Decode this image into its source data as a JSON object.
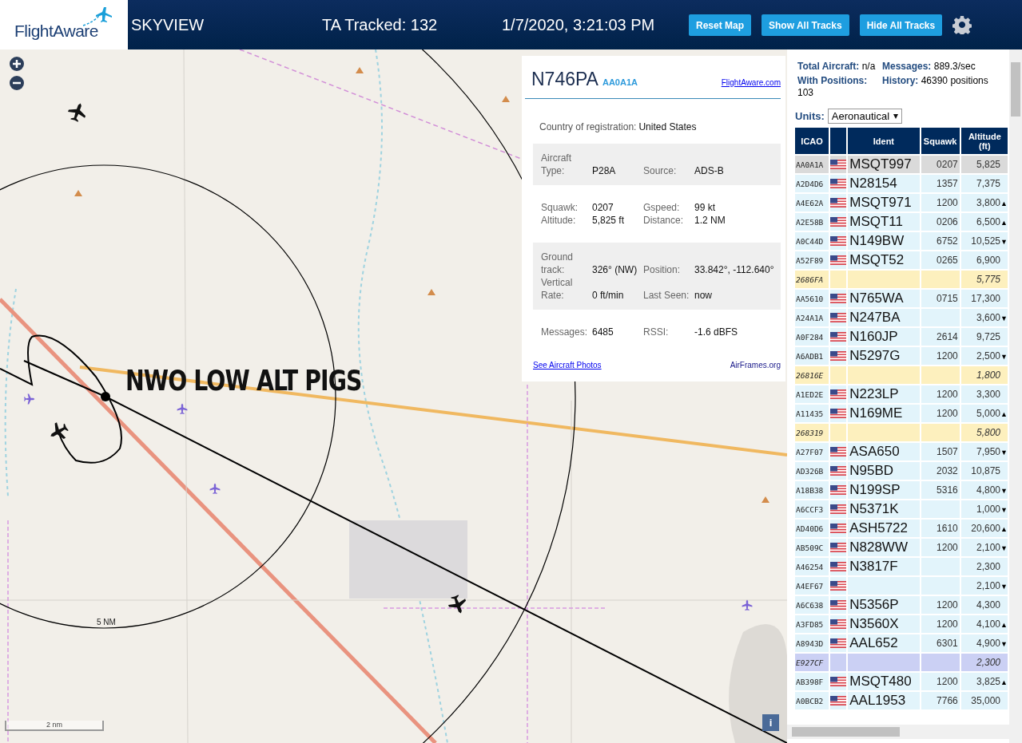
{
  "header": {
    "logo": "FlightAware",
    "title": "SKYVIEW",
    "tracked": "TA Tracked: 132",
    "datetime": "1/7/2020, 3:21:03 PM",
    "buttons": [
      "Reset Map",
      "Show All Tracks",
      "Hide All Tracks"
    ]
  },
  "map": {
    "annotation": "NWO LOW ALT PIGS",
    "ring_label": "5 NM",
    "scale": "2 nm",
    "info_button": "i"
  },
  "info": {
    "registration": "N746PA",
    "icao": "AA0A1A",
    "link": "FlightAware.com",
    "country_label": "Country of registration:",
    "country": "United States",
    "sections": [
      {
        "shaded": true,
        "fields": [
          {
            "label": "Aircraft Type:",
            "value": "P28A"
          },
          {
            "label": "Source:",
            "value": "ADS-B"
          }
        ]
      },
      {
        "shaded": false,
        "fields": [
          {
            "label": "Squawk:",
            "value": "0207"
          },
          {
            "label": "Gspeed:",
            "value": "99 kt"
          },
          {
            "label": "Altitude:",
            "value": "5,825 ft"
          },
          {
            "label": "Distance:",
            "value": "1.2 NM"
          }
        ]
      },
      {
        "shaded": true,
        "fields": [
          {
            "label": "Ground track:",
            "value": "326° (NW)"
          },
          {
            "label": "Position:",
            "value": "33.842°, -112.640°"
          },
          {
            "label": "Vertical Rate:",
            "value": "0 ft/min"
          },
          {
            "label": "Last Seen:",
            "value": "now"
          }
        ]
      },
      {
        "shaded": false,
        "fields": [
          {
            "label": "Messages:",
            "value": "6485"
          },
          {
            "label": "RSSI:",
            "value": "-1.6 dBFS"
          }
        ]
      }
    ],
    "photos_link": "See Aircraft Photos",
    "airframes_link": "AirFrames.org"
  },
  "stats": [
    {
      "label": "Total Aircraft:",
      "value": "n/a"
    },
    {
      "label": "Messages:",
      "value": "889.3/sec"
    },
    {
      "label": "With Positions:",
      "value": "103"
    },
    {
      "label": "History:",
      "value": "46390 positions"
    }
  ],
  "units": {
    "label": "Units:",
    "value": "Aeronautical"
  },
  "table": {
    "columns": [
      "ICAO",
      "",
      "Ident",
      "Squawk",
      "Altitude (ft)"
    ],
    "rows": [
      {
        "icao": "AA0A1A",
        "flag": true,
        "ident": "MSQT997",
        "squawk": "0207",
        "altitude": "5,825",
        "kind": "adsb",
        "selected": true
      },
      {
        "icao": "A2D4D6",
        "flag": true,
        "ident": "N28154",
        "squawk": "1357",
        "altitude": "7,375",
        "kind": "adsb",
        "selected": false
      },
      {
        "icao": "A4E62A",
        "flag": true,
        "ident": "MSQT971",
        "squawk": "1200",
        "altitude": "3,800",
        "trend": "▲",
        "kind": "adsb",
        "selected": false
      },
      {
        "icao": "A2E58B",
        "flag": true,
        "ident": "MSQT11",
        "squawk": "0206",
        "altitude": "6,500",
        "trend": "▲",
        "kind": "adsb",
        "selected": false
      },
      {
        "icao": "A0C44D",
        "flag": true,
        "ident": "N149BW",
        "squawk": "6752",
        "altitude": "10,525",
        "trend": "▼",
        "kind": "adsb",
        "selected": false
      },
      {
        "icao": "A52F89",
        "flag": true,
        "ident": "MSQT52",
        "squawk": "0265",
        "altitude": "6,900",
        "kind": "adsb",
        "selected": false
      },
      {
        "icao": "2686FA",
        "flag": false,
        "altitude": "5,775",
        "kind": "no_position",
        "selected": false
      },
      {
        "icao": "AA5610",
        "flag": true,
        "ident": "N765WA",
        "squawk": "0715",
        "altitude": "17,300",
        "kind": "adsb",
        "selected": false
      },
      {
        "icao": "A24A1A",
        "flag": true,
        "ident": "N247BA",
        "altitude": "3,600",
        "trend": "▼",
        "kind": "adsb",
        "selected": false
      },
      {
        "icao": "A0F284",
        "flag": true,
        "ident": "N160JP",
        "squawk": "2614",
        "altitude": "9,725",
        "kind": "adsb",
        "selected": false
      },
      {
        "icao": "A6ADB1",
        "flag": true,
        "ident": "N5297G",
        "squawk": "1200",
        "altitude": "2,500",
        "trend": "▼",
        "kind": "adsb",
        "selected": false
      },
      {
        "icao": "26816E",
        "flag": false,
        "altitude": "1,800",
        "kind": "no_position",
        "selected": false
      },
      {
        "icao": "A1ED2E",
        "flag": true,
        "ident": "N223LP",
        "squawk": "1200",
        "altitude": "3,300",
        "kind": "adsb",
        "selected": false
      },
      {
        "icao": "A11435",
        "flag": true,
        "ident": "N169ME",
        "squawk": "1200",
        "altitude": "5,000",
        "trend": "▲",
        "kind": "adsb",
        "selected": false
      },
      {
        "icao": "268319",
        "flag": false,
        "altitude": "5,800",
        "kind": "no_position",
        "selected": false
      },
      {
        "icao": "A27F07",
        "flag": true,
        "ident": "ASA650",
        "squawk": "1507",
        "altitude": "7,950",
        "trend": "▼",
        "kind": "adsb",
        "selected": false
      },
      {
        "icao": "AD326B",
        "flag": true,
        "ident": "N95BD",
        "squawk": "2032",
        "altitude": "10,875",
        "kind": "adsb",
        "selected": false
      },
      {
        "icao": "A18B38",
        "flag": true,
        "ident": "N199SP",
        "squawk": "5316",
        "altitude": "4,800",
        "trend": "▼",
        "kind": "adsb",
        "selected": false
      },
      {
        "icao": "A6CCF3",
        "flag": true,
        "ident": "N5371K",
        "altitude": "1,000",
        "trend": "▼",
        "kind": "adsb",
        "selected": false
      },
      {
        "icao": "AD40D6",
        "flag": true,
        "ident": "ASH5722",
        "squawk": "1610",
        "altitude": "20,600",
        "trend": "▲",
        "kind": "adsb",
        "selected": false
      },
      {
        "icao": "AB509C",
        "flag": true,
        "ident": "N828WW",
        "squawk": "1200",
        "altitude": "2,100",
        "trend": "▼",
        "kind": "adsb",
        "selected": false
      },
      {
        "icao": "A46254",
        "flag": true,
        "ident": "N3817F",
        "altitude": "2,300",
        "kind": "adsb",
        "selected": false
      },
      {
        "icao": "A4EF67",
        "flag": true,
        "altitude": "2,100",
        "trend": "▼",
        "kind": "adsb",
        "selected": false
      },
      {
        "icao": "A6C638",
        "flag": true,
        "ident": "N5356P",
        "squawk": "1200",
        "altitude": "4,300",
        "kind": "adsb",
        "selected": false
      },
      {
        "icao": "A3FD85",
        "flag": true,
        "ident": "N3560X",
        "squawk": "1200",
        "altitude": "4,100",
        "trend": "▲",
        "kind": "adsb",
        "selected": false
      },
      {
        "icao": "A8943D",
        "flag": true,
        "ident": "AAL652",
        "squawk": "6301",
        "altitude": "4,900",
        "trend": "▼",
        "kind": "adsb",
        "selected": false
      },
      {
        "icao": "E927CF",
        "flag": false,
        "altitude": "2,300",
        "kind": "mlat",
        "selected": false
      },
      {
        "icao": "AB398F",
        "flag": true,
        "ident": "MSQT480",
        "squawk": "1200",
        "altitude": "3,825",
        "trend": "▲",
        "kind": "adsb",
        "selected": false
      },
      {
        "icao": "A0BCB2",
        "flag": true,
        "ident": "AAL1953",
        "squawk": "7766",
        "altitude": "35,000",
        "kind": "adsb",
        "selected": false
      }
    ]
  }
}
